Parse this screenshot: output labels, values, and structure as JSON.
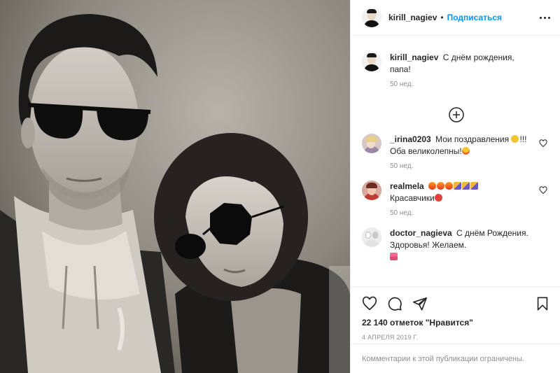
{
  "header": {
    "username": "kirill_nagiev",
    "separator": "•",
    "follow_label": "Подписаться"
  },
  "caption": {
    "username": "kirill_nagiev",
    "text": "С днём рождения, папа!",
    "time": "50 нед."
  },
  "comments": [
    {
      "username": "_irina0203",
      "text_before": "Мои поздравления",
      "text_after": "!!! Оба великолепны!",
      "time": "50 нед.",
      "emoji_1": "face-with-party-hat",
      "emoji_2": "star-struck-face"
    },
    {
      "username": "realmela",
      "emojis": [
        "fire",
        "fire",
        "fire",
        "party-popper",
        "party-popper",
        "party-popper"
      ],
      "text": "Красавчики",
      "emoji_end": "balloon",
      "time": "50 нед."
    },
    {
      "username": "doctor_nagieva",
      "text": "С днём Рождения. Здоровья! Желаем.",
      "emoji_end": "birthday-cake"
    }
  ],
  "actions": {
    "likes": "22 140 отметок \"Нравится\"",
    "date": "4 АПРЕЛЯ 2019 Г."
  },
  "footer": {
    "comments_limited": "Комментарии к этой публикации ограничены."
  },
  "colors": {
    "accent": "#0095f6",
    "text": "#262626",
    "secondary": "#8e8e8e",
    "border": "#efefef"
  }
}
